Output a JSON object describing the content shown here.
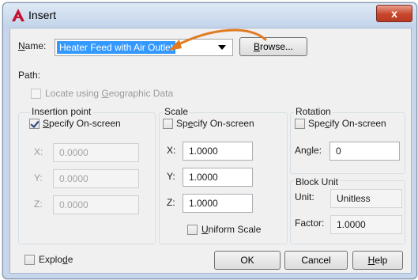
{
  "window": {
    "title": "Insert",
    "close_label": "x"
  },
  "name_row": {
    "label_prefix": "N",
    "label_rest": "ame:",
    "value": "Heater Feed with Air Outlet",
    "browse_prefix": "B",
    "browse_rest": "rowse..."
  },
  "path": {
    "label": "Path:"
  },
  "geo": {
    "pre": "Locate using ",
    "key": "G",
    "post": "eographic Data"
  },
  "insertion": {
    "title": "Insertion point",
    "specify": {
      "pre": "",
      "key": "S",
      "post": "pecify On-screen"
    },
    "x": {
      "label": "X:",
      "value": "0.0000"
    },
    "y": {
      "label": "Y:",
      "value": "0.0000"
    },
    "z": {
      "label": "Z:",
      "value": "0.0000"
    }
  },
  "scale": {
    "title": "Scale",
    "specify": {
      "pre": "Sp",
      "key": "e",
      "post": "cify On-screen"
    },
    "x": {
      "label": "X:",
      "value": "1.0000"
    },
    "y": {
      "label": "Y:",
      "value": "1.0000"
    },
    "z": {
      "label": "Z:",
      "value": "1.0000"
    },
    "uniform": {
      "pre": "",
      "key": "U",
      "post": "niform Scale"
    }
  },
  "rotation": {
    "title": "Rotation",
    "specify": {
      "pre": "Spe",
      "key": "c",
      "post": "ify On-screen"
    },
    "angle": {
      "label": "Angle:",
      "value": "0"
    }
  },
  "block_unit": {
    "title": "Block Unit",
    "unit": {
      "label": "Unit:",
      "value": "Unitless"
    },
    "factor": {
      "label": "Factor:",
      "value": "1.0000"
    }
  },
  "explode": {
    "pre": "Explo",
    "key": "d",
    "post": "e"
  },
  "buttons": {
    "ok": "OK",
    "cancel": "Cancel",
    "help_key": "H",
    "help_rest": "elp"
  },
  "colors": {
    "selection": "#3399ff",
    "arrow": "#e07b22",
    "close": "#c8452c"
  }
}
